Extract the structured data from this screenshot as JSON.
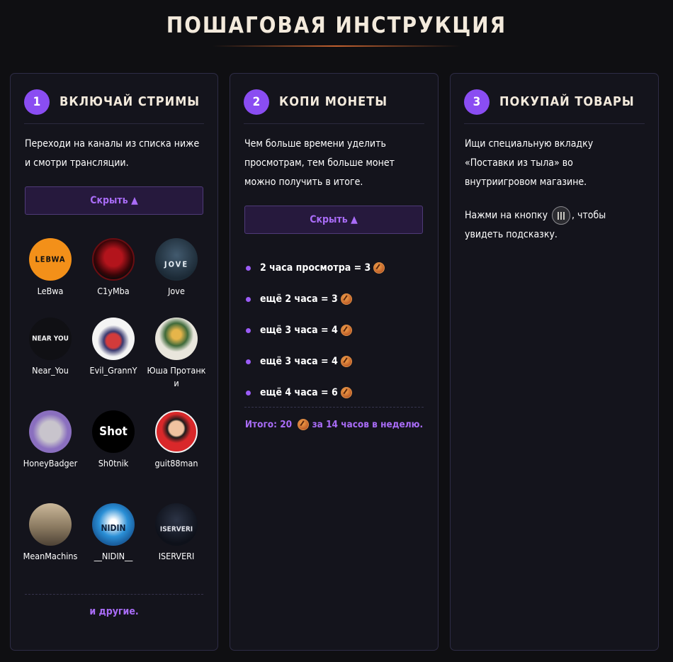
{
  "page": {
    "title": "ПОШАГОВАЯ ИНСТРУКЦИЯ"
  },
  "colors": {
    "accent": "#8a4df2",
    "accent_text": "#a96cf7",
    "background": "#0f0f12",
    "card": "#14141c"
  },
  "step1": {
    "number": "1",
    "title": "ВКЛЮЧАЙ СТРИМЫ",
    "description": "Переходи на каналы из списка ниже и смотри трансляции.",
    "toggle_label": "Скрыть ▲",
    "streamers": [
      {
        "name": "LeBwa",
        "avatar_text": "LEBWA"
      },
      {
        "name": "C1yMba",
        "avatar_text": ""
      },
      {
        "name": "Jove",
        "avatar_text": "JOVE"
      },
      {
        "name": "Near_You",
        "avatar_text": "NEAR YOU"
      },
      {
        "name": "Evil_GrannY",
        "avatar_text": ""
      },
      {
        "name": "Юша Протанки",
        "avatar_text": ""
      },
      {
        "name": "HoneyBadger",
        "avatar_text": ""
      },
      {
        "name": "Sh0tnik",
        "avatar_text": "Shot"
      },
      {
        "name": "guit88man",
        "avatar_text": ""
      },
      {
        "name": "MeanMachins",
        "avatar_text": ""
      },
      {
        "name": "__NIDIN__",
        "avatar_text": "NIDIN"
      },
      {
        "name": "ISERVERI",
        "avatar_text": "ISERVERI"
      }
    ],
    "others_label": "и другие."
  },
  "step2": {
    "number": "2",
    "title": "КОПИ МОНЕТЫ",
    "description": "Чем больше времени уделить просмотрам, тем больше монет можно получить в итоге.",
    "toggle_label": "Скрыть ▲",
    "rates": [
      "2 часа просмотра = 3",
      "ещё 2 часа = 3",
      "ещё 3 часа = 4",
      "ещё 3 часа = 4",
      "ещё 4 часа = 6"
    ],
    "total_prefix": "Итого: 20",
    "total_suffix": "за 14 часов в неделю."
  },
  "step3": {
    "number": "3",
    "title": "ПОКУПАЙ ТОВАРЫ",
    "description": "Ищи специальную вкладку «Поставки из тыла» во внутриигровом магазине.",
    "hint_prefix": "Нажми на кнопку",
    "hint_suffix": ", чтобы увидеть подсказку."
  }
}
